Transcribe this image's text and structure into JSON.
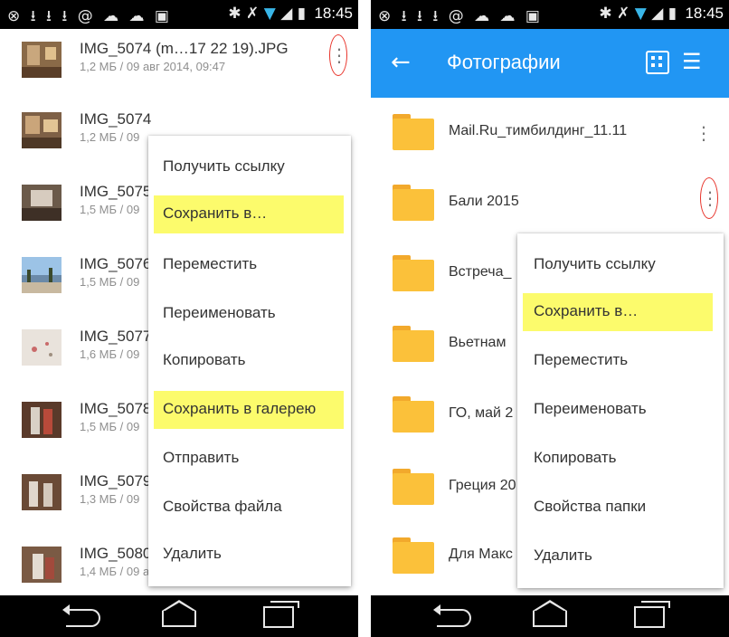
{
  "status_bar": {
    "left_icons": "⊗ ⭳ ⭳ ⭳ @ ☁ ☁ ▣",
    "right_icons": "✱ ✗",
    "time": "18:45"
  },
  "left": {
    "files": [
      {
        "name": "IMG_5074 (m…17 22 19).JPG",
        "meta": "1,2 МБ / 09 авг 2014, 09:47"
      },
      {
        "name": "IMG_5074",
        "meta": "1,2 МБ / 09"
      },
      {
        "name": "IMG_5075",
        "meta": "1,5 МБ / 09"
      },
      {
        "name": "IMG_5076",
        "meta": "1,5 МБ / 09"
      },
      {
        "name": "IMG_5077",
        "meta": "1,6 МБ / 09"
      },
      {
        "name": "IMG_5078",
        "meta": "1,5 МБ / 09"
      },
      {
        "name": "IMG_5079",
        "meta": "1,3 МБ / 09"
      },
      {
        "name": "IMG_5080",
        "meta": "1,4 МБ / 09 авг 2014, 13:16"
      }
    ],
    "menu": [
      {
        "label": "Получить ссылку",
        "highlighted": false
      },
      {
        "label": "Сохранить в…",
        "highlighted": true
      },
      {
        "label": "Переместить",
        "highlighted": false
      },
      {
        "label": "Переименовать",
        "highlighted": false
      },
      {
        "label": "Копировать",
        "highlighted": false
      },
      {
        "label": "Сохранить в галерею",
        "highlighted": true
      },
      {
        "label": "Отправить",
        "highlighted": false
      },
      {
        "label": "Свойства файла",
        "highlighted": false
      },
      {
        "label": "Удалить",
        "highlighted": false
      }
    ]
  },
  "right": {
    "title": "Фотографии",
    "folders": [
      {
        "name": "Mail.Ru_тимбилдинг_11.11"
      },
      {
        "name": "Бали 2015"
      },
      {
        "name": "Встреча_"
      },
      {
        "name": "Вьетнам"
      },
      {
        "name": "ГО, май 2"
      },
      {
        "name": "Греция 20"
      },
      {
        "name": "Для Макс"
      }
    ],
    "menu": [
      {
        "label": "Получить ссылку",
        "highlighted": false
      },
      {
        "label": "Сохранить в…",
        "highlighted": true
      },
      {
        "label": "Переместить",
        "highlighted": false
      },
      {
        "label": "Переименовать",
        "highlighted": false
      },
      {
        "label": "Копировать",
        "highlighted": false
      },
      {
        "label": "Свойства папки",
        "highlighted": false
      },
      {
        "label": "Удалить",
        "highlighted": false
      }
    ]
  },
  "colors": {
    "app_bar": "#2196f3",
    "highlight": "#fcfb6c",
    "folder": "#fbc13a",
    "annotation_circle": "#e8332a"
  }
}
